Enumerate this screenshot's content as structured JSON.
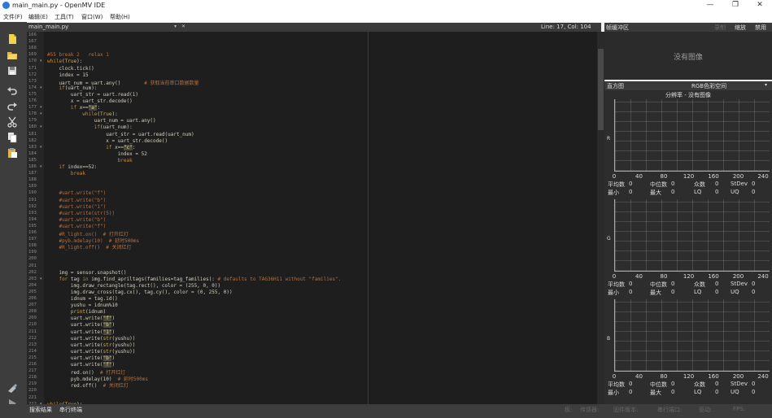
{
  "window": {
    "title": "main_main.py - OpenMV IDE",
    "controls": [
      "—",
      "❐",
      "✕"
    ]
  },
  "menu": [
    "文件(F)",
    "编辑(E)",
    "工具(T)",
    "窗口(W)",
    "帮助(H)"
  ],
  "toolbar_icons": [
    "new-file-icon",
    "open-folder-icon",
    "save-icon",
    "undo-icon",
    "redo-icon",
    "cut-icon",
    "copy-icon",
    "paste-icon",
    "connect-icon",
    "run-icon"
  ],
  "editor": {
    "filename": "main_main.py",
    "cursor_position": "Line: 17, Col: 104",
    "colors": {
      "background": "#1e1e1e",
      "keyword": "#c08a3e",
      "comment": "#b5703f",
      "text": "#d4cfc0",
      "builtin": "#d9b34a"
    },
    "lines": [
      {
        "n": "166",
        "f": "",
        "t": ""
      },
      {
        "n": "167",
        "f": "",
        "t": ""
      },
      {
        "n": "168",
        "f": "",
        "t": ""
      },
      {
        "n": "169",
        "f": "",
        "t": "#55 break 2   relax 1"
      },
      {
        "n": "170",
        "f": "▾",
        "t": "while(True):"
      },
      {
        "n": "171",
        "f": "",
        "t": "    clock.tick()"
      },
      {
        "n": "172",
        "f": "",
        "t": "    index = 15"
      },
      {
        "n": "173",
        "f": "",
        "t": "    uart_num = uart.any()        # 获取当前串口数据数量"
      },
      {
        "n": "174",
        "f": "▾",
        "t": "    if(uart_num):"
      },
      {
        "n": "175",
        "f": "",
        "t": "        uart_str = uart.read(1)"
      },
      {
        "n": "176",
        "f": "",
        "t": "        x = uart_str.decode()"
      },
      {
        "n": "177",
        "f": "▾",
        "t": "        if x==\"a\":"
      },
      {
        "n": "178",
        "f": "▾",
        "t": "            while(True):"
      },
      {
        "n": "179",
        "f": "",
        "t": "                uart_num = uart.any()"
      },
      {
        "n": "180",
        "f": "▾",
        "t": "                if(uart_num):"
      },
      {
        "n": "181",
        "f": "",
        "t": "                    uart_str = uart.read(uart_num)"
      },
      {
        "n": "182",
        "f": "",
        "t": "                    x = uart_str.decode()"
      },
      {
        "n": "183",
        "f": "▾",
        "t": "                    if x==\"c\":"
      },
      {
        "n": "184",
        "f": "",
        "t": "                        index = 52"
      },
      {
        "n": "185",
        "f": "",
        "t": "                        break"
      },
      {
        "n": "186",
        "f": "▾",
        "t": "    if index==52:"
      },
      {
        "n": "187",
        "f": "",
        "t": "        break"
      },
      {
        "n": "188",
        "f": "",
        "t": ""
      },
      {
        "n": "189",
        "f": "",
        "t": ""
      },
      {
        "n": "190",
        "f": "",
        "t": "    #uart.write(\"f\")"
      },
      {
        "n": "191",
        "f": "",
        "t": "    #uart.write(\"b\")"
      },
      {
        "n": "192",
        "f": "",
        "t": "    #uart.write(\"1\")"
      },
      {
        "n": "193",
        "f": "",
        "t": "    #uart.write(str(5))"
      },
      {
        "n": "194",
        "f": "",
        "t": "    #uart.write(\"b\")"
      },
      {
        "n": "195",
        "f": "",
        "t": "    #uart.write(\"f\")"
      },
      {
        "n": "196",
        "f": "",
        "t": "    #R_light.on()  # 打开红灯"
      },
      {
        "n": "197",
        "f": "",
        "t": "    #pyb.mdelay(10)  # 延时500ms"
      },
      {
        "n": "198",
        "f": "",
        "t": "    #R_light.off()  # 关闭红灯"
      },
      {
        "n": "199",
        "f": "",
        "t": ""
      },
      {
        "n": "200",
        "f": "",
        "t": ""
      },
      {
        "n": "201",
        "f": "",
        "t": ""
      },
      {
        "n": "202",
        "f": "",
        "t": "    img = sensor.snapshot()"
      },
      {
        "n": "203",
        "f": "▾",
        "t": "    for tag in img.find_apriltags(families=tag_families): # defaults to TAG36H11 without \"families\"."
      },
      {
        "n": "204",
        "f": "",
        "t": "        img.draw_rectangle(tag.rect(), color = (255, 0, 0))"
      },
      {
        "n": "205",
        "f": "",
        "t": "        img.draw_cross(tag.cx(), tag.cy(), color = (0, 255, 0))"
      },
      {
        "n": "206",
        "f": "",
        "t": "        idnum = tag.id()"
      },
      {
        "n": "207",
        "f": "",
        "t": "        yushu = idnum%10"
      },
      {
        "n": "208",
        "f": "",
        "t": "        print(idnum)"
      },
      {
        "n": "209",
        "f": "",
        "t": "        uart.write(\"f\")"
      },
      {
        "n": "210",
        "f": "",
        "t": "        uart.write(\"b\")"
      },
      {
        "n": "211",
        "f": "",
        "t": "        uart.write(\"1\")"
      },
      {
        "n": "212",
        "f": "",
        "t": "        uart.write(str(yushu))"
      },
      {
        "n": "213",
        "f": "",
        "t": "        uart.write(str(yushu))"
      },
      {
        "n": "214",
        "f": "",
        "t": "        uart.write(str(yushu))"
      },
      {
        "n": "215",
        "f": "",
        "t": "        uart.write(\"b\")"
      },
      {
        "n": "216",
        "f": "",
        "t": "        uart.write(\"f\")"
      },
      {
        "n": "217",
        "f": "",
        "t": "        red.on()  # 打开红灯"
      },
      {
        "n": "218",
        "f": "",
        "t": "        pyb.mdelay(10)  # 延时500ms"
      },
      {
        "n": "219",
        "f": "",
        "t": "        red.off()  # 关闭红灯"
      },
      {
        "n": "220",
        "f": "",
        "t": ""
      },
      {
        "n": "221",
        "f": "",
        "t": ""
      },
      {
        "n": "222",
        "f": "▾",
        "t": "while(True):"
      }
    ]
  },
  "frame_buffer": {
    "title": "帧缓冲区",
    "record_label": "录制",
    "zoom_label": "缩放",
    "disable_label": "禁用",
    "empty_text": "没有图像"
  },
  "histogram": {
    "title": "直方图",
    "colorspace": "RGB色彩空间",
    "resolution": "分辨率 - 没有图像",
    "x_ticks": [
      "0",
      "40",
      "80",
      "120",
      "160",
      "200",
      "240"
    ],
    "stat_labels": {
      "mean": "平均数",
      "median": "中位数",
      "mode": "众数",
      "stdev": "StDev",
      "min": "最小",
      "max": "最大",
      "lq": "LQ",
      "uq": "UQ"
    },
    "channels": [
      {
        "label": "R",
        "mean": "0",
        "median": "0",
        "mode": "0",
        "stdev": "0",
        "min": "0",
        "max": "0",
        "lq": "0",
        "uq": "0"
      },
      {
        "label": "G",
        "mean": "0",
        "median": "0",
        "mode": "0",
        "stdev": "0",
        "min": "0",
        "max": "0",
        "lq": "0",
        "uq": "0"
      },
      {
        "label": "B",
        "mean": "0",
        "median": "0",
        "mode": "0",
        "stdev": "0",
        "min": "0",
        "max": "0",
        "lq": "0",
        "uq": "0"
      }
    ]
  },
  "statusbar": {
    "search_results": "搜索结果",
    "serial_terminal": "串行终端",
    "board": "板:",
    "sensor": "传感器:",
    "firmware": "固件版本:",
    "serial_port": "串行端口:",
    "drive": "驱动:",
    "fps": "FPS:"
  }
}
